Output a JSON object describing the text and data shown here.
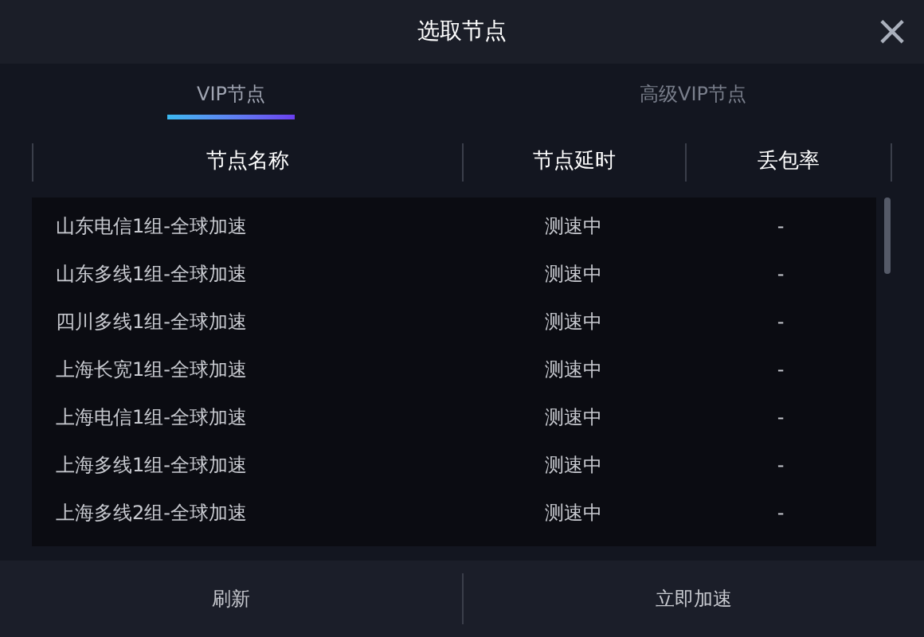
{
  "window": {
    "title": "选取节点",
    "close": "×"
  },
  "tabs": [
    {
      "label": "VIP节点",
      "selected": true
    },
    {
      "label": "高级VIP节点",
      "selected": false
    }
  ],
  "table": {
    "columns": [
      "节点名称",
      "节点延时",
      "丢包率"
    ],
    "rows": [
      {
        "name": "山东电信1组-全球加速",
        "latency": "测速中",
        "loss": "-"
      },
      {
        "name": "山东多线1组-全球加速",
        "latency": "测速中",
        "loss": "-"
      },
      {
        "name": "四川多线1组-全球加速",
        "latency": "测速中",
        "loss": "-"
      },
      {
        "name": "上海长宽1组-全球加速",
        "latency": "测速中",
        "loss": "-"
      },
      {
        "name": "上海电信1组-全球加速",
        "latency": "测速中",
        "loss": "-"
      },
      {
        "name": "上海多线1组-全球加速",
        "latency": "测速中",
        "loss": "-"
      },
      {
        "name": "上海多线2组-全球加速",
        "latency": "测速中",
        "loss": "-"
      }
    ]
  },
  "buttons": [
    {
      "label": "刷新"
    },
    {
      "label": "立即加速"
    }
  ]
}
